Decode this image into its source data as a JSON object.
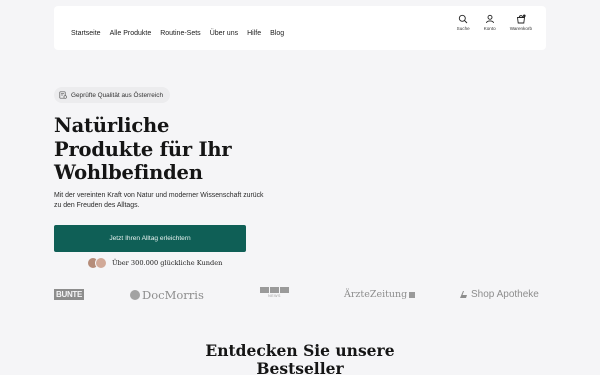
{
  "nav": {
    "items": [
      "Startseite",
      "Alle Produkte",
      "Routine-Sets",
      "Über uns",
      "Hilfe",
      "Blog"
    ]
  },
  "actions": {
    "search": {
      "label": "Suche",
      "icon": "search-icon"
    },
    "account": {
      "label": "Konto",
      "icon": "user-icon"
    },
    "cart": {
      "label": "Warenkorb",
      "icon": "cart-icon"
    }
  },
  "hero": {
    "badge": "Geprüfte Qualität aus Österreich",
    "title_lines": [
      "Natürliche",
      "Produkte für Ihr",
      "Wohlbefinden"
    ],
    "subtitle": "Mit der vereinten Kraft von Natur und moderner Wissenschaft zurück zu den Freuden des Alltags.",
    "cta": "Jetzt Ihren Alltag erleichtern",
    "social_proof": "Über 300.000 glückliche Kunden"
  },
  "logos": {
    "bunte": "BUNTE",
    "docmorris": "DocMorris",
    "rtl": "NEWS",
    "aerztezeitung": "ÄrzteZeitung",
    "shopapotheke": "Shop Apotheke"
  },
  "section": {
    "title_lines": [
      "Entdecken Sie unsere",
      "Bestseller"
    ]
  },
  "colors": {
    "accent": "#0f5f56",
    "background": "#f5f5f7",
    "header_bg": "#ffffff",
    "logo_grey": "#8d8d8d"
  }
}
